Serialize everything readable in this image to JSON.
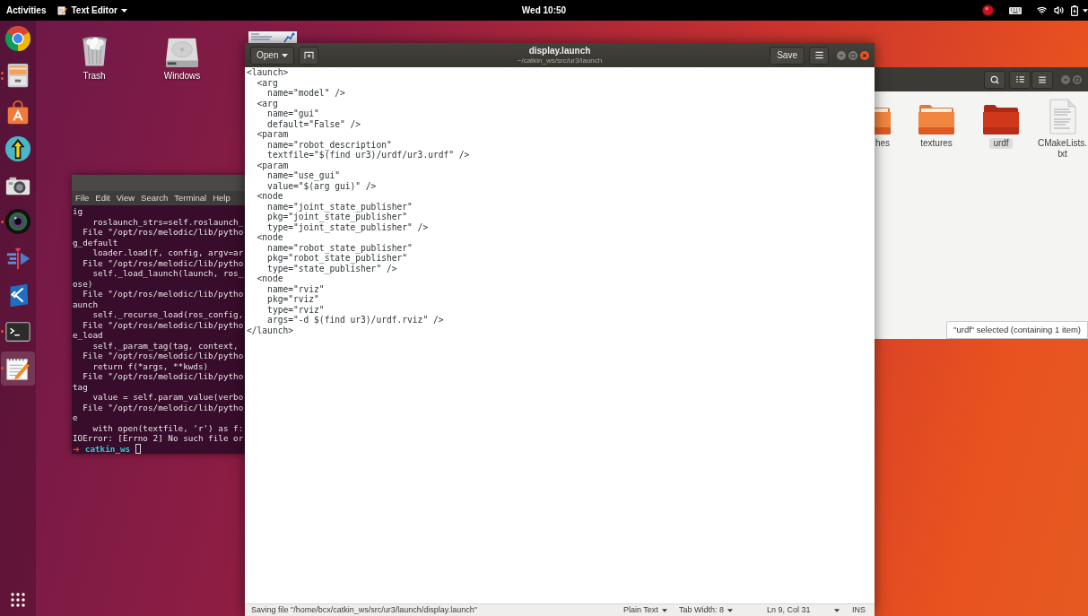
{
  "top_bar": {
    "activities": "Activities",
    "app_menu": "Text Editor",
    "clock": "Wed 10:50"
  },
  "dock": {
    "items": [
      {
        "kind": "browser",
        "running": false,
        "selected": false
      },
      {
        "kind": "files",
        "running": true,
        "two_windows": true,
        "selected": false
      },
      {
        "kind": "store",
        "running": false,
        "selected": false
      },
      {
        "kind": "arrow_badge",
        "running": false,
        "selected": false
      },
      {
        "kind": "camera",
        "running": false,
        "selected": false
      },
      {
        "kind": "lens",
        "running": true,
        "two_windows": false,
        "selected": false
      },
      {
        "kind": "arrow_lines",
        "running": false,
        "selected": false
      },
      {
        "kind": "code",
        "running": false,
        "selected": false
      },
      {
        "kind": "terminal",
        "running": true,
        "two_windows": false,
        "selected": false
      },
      {
        "kind": "text_editor",
        "running": true,
        "two_windows": false,
        "selected": true
      }
    ]
  },
  "desktop_icons": [
    {
      "kind": "trash",
      "label": "Trash"
    },
    {
      "kind": "drive",
      "label": "Windows"
    }
  ],
  "terminal": {
    "menu": [
      "File",
      "Edit",
      "View",
      "Search",
      "Terminal",
      "Help"
    ],
    "lines": [
      "ig",
      "    roslaunch_strs=self.roslaunch_",
      "  File \"/opt/ros/melodic/lib/pytho",
      "g_default",
      "    loader.load(f, config, argv=ar",
      "  File \"/opt/ros/melodic/lib/pytho",
      "    self._load_launch(launch, ros_",
      "ose)",
      "  File \"/opt/ros/melodic/lib/pytho",
      "aunch",
      "    self._recurse_load(ros_config,",
      "  File \"/opt/ros/melodic/lib/pytho",
      "e_load",
      "    self._param_tag(tag, context,",
      "  File \"/opt/ros/melodic/lib/pytho",
      "    return f(*args, **kwds)",
      "  File \"/opt/ros/melodic/lib/pytho",
      "tag",
      "    value = self.param_value(verbo",
      "  File \"/opt/ros/melodic/lib/pytho",
      "e",
      "    with open(textfile, 'r') as f:",
      "IOError: [Errno 2] No such file or"
    ],
    "prompt": {
      "arrow": "➜",
      "directory": "catkin_ws"
    }
  },
  "editor": {
    "open_button": "Open",
    "title": "display.launch",
    "subtitle": "~/catkin_ws/src/ur3/launch",
    "save_button": "Save",
    "lines": [
      "<launch>",
      "  <arg",
      "    name=\"model\" />",
      "  <arg",
      "    name=\"gui\"",
      "    default=\"False\" />",
      "  <param",
      "    name=\"robot_description\"",
      "    textfile=\"$(find ur3)/urdf/ur3.urdf\" />",
      "  <param",
      "    name=\"use_gui\"",
      "    value=\"$(arg gui)\" />",
      "  <node",
      "    name=\"joint_state_publisher\"",
      "    pkg=\"joint_state_publisher\"",
      "    type=\"joint_state_publisher\" />",
      "  <node",
      "    name=\"robot_state_publisher\"",
      "    pkg=\"robot_state_publisher\"",
      "    type=\"state_publisher\" />",
      "  <node",
      "    name=\"rviz\"",
      "    pkg=\"rviz\"",
      "    type=\"rviz\"",
      "    args=\"-d $(find ur3)/urdf.rviz\" />",
      "</launch>"
    ],
    "status_bar": {
      "message": "Saving file \"/home/bcx/catkin_ws/src/ur3/launch/display.launch\"",
      "language": "Plain Text",
      "tab_width": "Tab Width: 8",
      "position": "Ln 9, Col 31",
      "mode": "INS"
    }
  },
  "file_manager": {
    "items": [
      {
        "kind": "folder",
        "label": "hes",
        "cut_off": true,
        "selected": false
      },
      {
        "kind": "folder",
        "label": "textures",
        "cut_off": false,
        "selected": false
      },
      {
        "kind": "folder",
        "label": "urdf",
        "cut_off": false,
        "selected": true
      },
      {
        "kind": "text_file",
        "label": "CMakeLists.txt",
        "cut_off": false,
        "selected": false
      }
    ],
    "status": "\"urdf\" selected (containing 1 item)"
  }
}
